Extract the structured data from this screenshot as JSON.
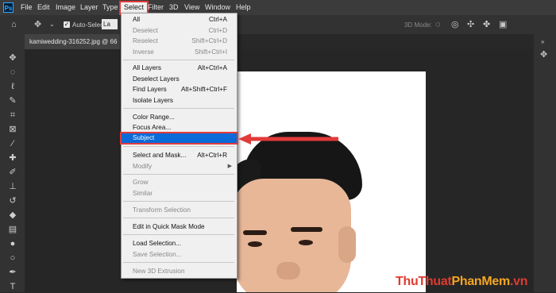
{
  "app": {
    "logo": "Ps"
  },
  "menubar": {
    "items": [
      "File",
      "Edit",
      "Image",
      "Layer",
      "Type",
      "Select",
      "Filter",
      "3D",
      "View",
      "Window",
      "Help"
    ],
    "active": "Select"
  },
  "options": {
    "auto_select_label": "Auto-Select:",
    "auto_select_value": "La",
    "mode_3d": "3D Mode:"
  },
  "document": {
    "tab_title": "kamiwedding-316252.jpg @ 66"
  },
  "select_menu": {
    "items": [
      {
        "label": "All",
        "shortcut": "Ctrl+A",
        "disabled": false
      },
      {
        "label": "Deselect",
        "shortcut": "Ctrl+D",
        "disabled": true
      },
      {
        "label": "Reselect",
        "shortcut": "Shift+Ctrl+D",
        "disabled": true
      },
      {
        "label": "Inverse",
        "shortcut": "Shift+Ctrl+I",
        "disabled": true
      },
      {
        "label": "All Layers",
        "shortcut": "Alt+Ctrl+A",
        "disabled": false
      },
      {
        "label": "Deselect Layers",
        "shortcut": "",
        "disabled": false
      },
      {
        "label": "Find Layers",
        "shortcut": "Alt+Shift+Ctrl+F",
        "disabled": false
      },
      {
        "label": "Isolate Layers",
        "shortcut": "",
        "disabled": false
      },
      {
        "label": "Color Range...",
        "shortcut": "",
        "disabled": false
      },
      {
        "label": "Focus Area...",
        "shortcut": "",
        "disabled": false
      },
      {
        "label": "Subject",
        "shortcut": "",
        "disabled": false,
        "highlighted": true
      },
      {
        "label": "Select and Mask...",
        "shortcut": "Alt+Ctrl+R",
        "disabled": false
      },
      {
        "label": "Modify",
        "shortcut": "",
        "disabled": true,
        "submenu": true
      },
      {
        "label": "Grow",
        "shortcut": "",
        "disabled": true
      },
      {
        "label": "Similar",
        "shortcut": "",
        "disabled": true
      },
      {
        "label": "Transform Selection",
        "shortcut": "",
        "disabled": true
      },
      {
        "label": "Edit in Quick Mask Mode",
        "shortcut": "",
        "disabled": false
      },
      {
        "label": "Load Selection...",
        "shortcut": "",
        "disabled": false
      },
      {
        "label": "Save Selection...",
        "shortcut": "",
        "disabled": true
      },
      {
        "label": "New 3D Extrusion",
        "shortcut": "",
        "disabled": true
      }
    ]
  },
  "watermark": {
    "part1": "ThuThuat",
    "part2": "PhanMem",
    "part3": ".vn"
  },
  "colors": {
    "highlight": "#0a6ad8",
    "annotation_red": "#e23a3a"
  }
}
